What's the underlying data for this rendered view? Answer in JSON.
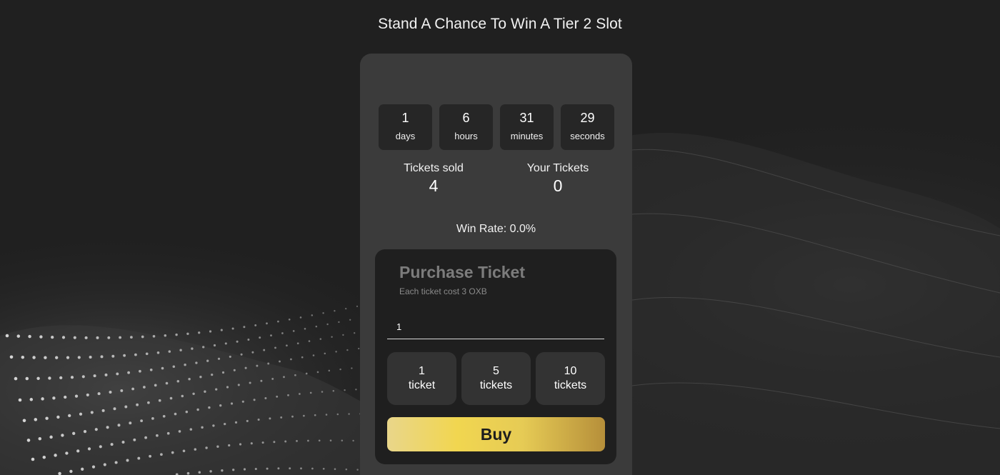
{
  "page": {
    "title": "Stand A Chance To Win A Tier 2 Slot"
  },
  "countdown": [
    {
      "value": "1",
      "unit": "days"
    },
    {
      "value": "6",
      "unit": "hours"
    },
    {
      "value": "31",
      "unit": "minutes"
    },
    {
      "value": "29",
      "unit": "seconds"
    }
  ],
  "stats": {
    "tickets_sold": {
      "label": "Tickets sold",
      "value": "4"
    },
    "your_tickets": {
      "label": "Your Tickets",
      "value": "0"
    }
  },
  "win_rate": "Win Rate: 0.0%",
  "purchase": {
    "title": "Purchase Ticket",
    "subtitle": "Each ticket cost 3 OXB",
    "quantity_value": "1",
    "presets": [
      {
        "count": "1",
        "unit": "ticket"
      },
      {
        "count": "5",
        "unit": "tickets"
      },
      {
        "count": "10",
        "unit": "tickets"
      }
    ],
    "buy_label": "Buy"
  },
  "colors": {
    "background": "#202020",
    "card": "#3b3b3b",
    "panel": "#1f1f1f",
    "buy_gradient_start": "#e9d68a",
    "buy_gradient_end": "#b68f3a"
  }
}
